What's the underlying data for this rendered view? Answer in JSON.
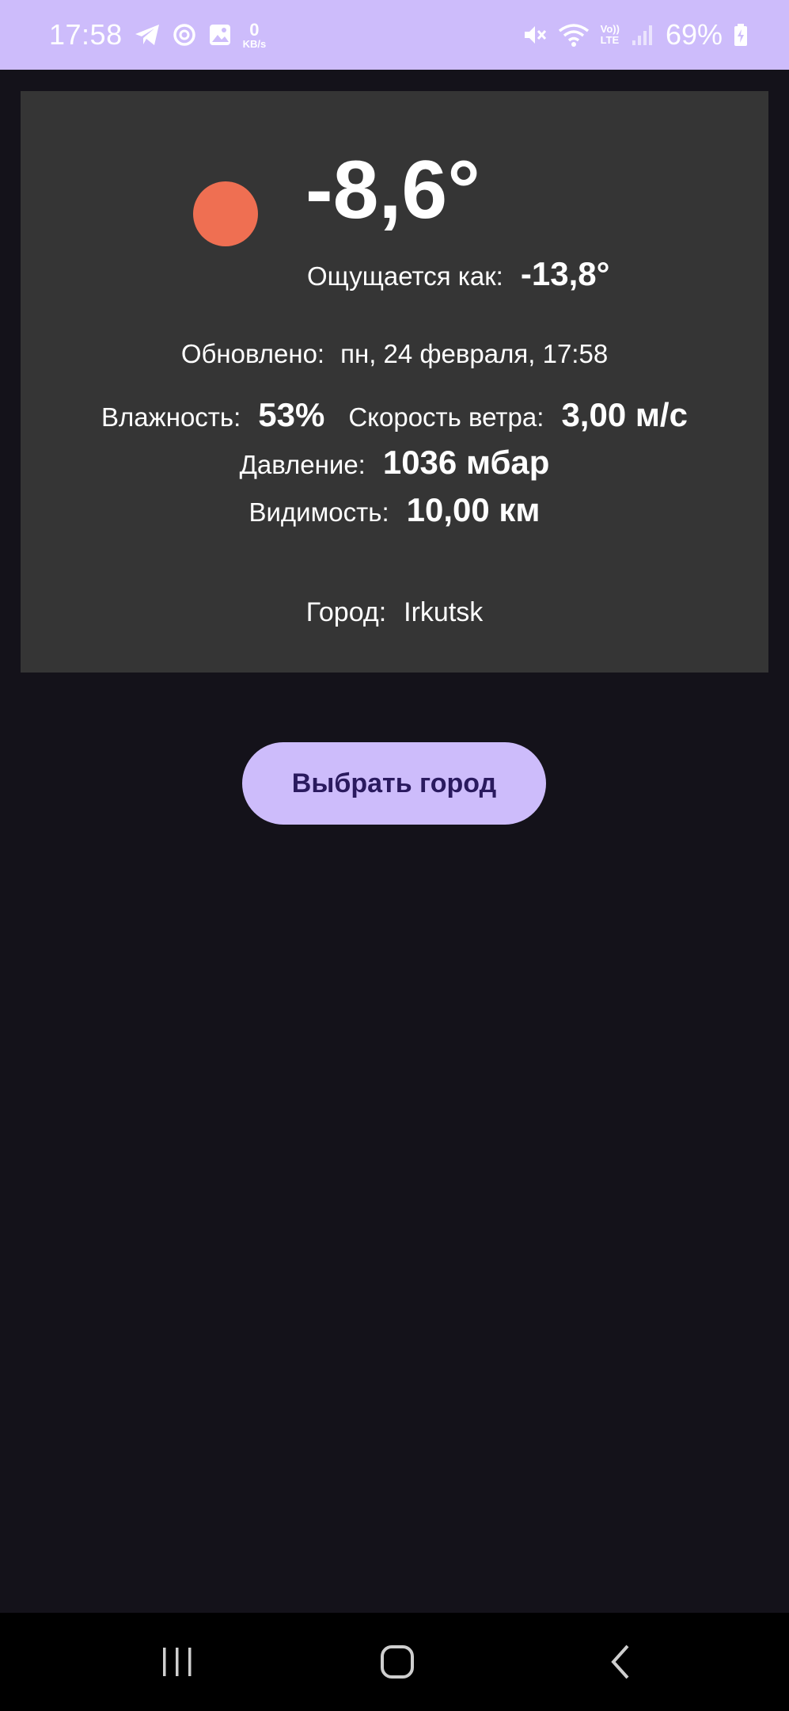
{
  "status_bar": {
    "time": "17:58",
    "data_speed_value": "0",
    "data_speed_unit": "KB/s",
    "lte_top": "Vo))",
    "lte_bottom": "LTE",
    "battery_percent": "69%",
    "icons": [
      "telegram-icon",
      "sync-icon",
      "gallery-icon",
      "mute-icon",
      "wifi-icon",
      "signal-icon",
      "battery-icon"
    ]
  },
  "weather": {
    "temperature": "-8,6°",
    "feels_like_label": "Ощущается как:",
    "feels_like_value": "-13,8°",
    "updated_label": "Обновлено:",
    "updated_value": "пн, 24 февраля, 17:58",
    "humidity_label": "Влажность:",
    "humidity_value": "53%",
    "wind_label": "Скорость ветра:",
    "wind_value": "3,00 м/с",
    "pressure_label": "Давление:",
    "pressure_value": "1036 мбар",
    "visibility_label": "Видимость:",
    "visibility_value": "10,00 км",
    "city_label": "Город:",
    "city_value": "Irkutsk",
    "icon": "sun-icon",
    "icon_color": "#ef6f52"
  },
  "actions": {
    "choose_city_label": "Выбрать город"
  },
  "colors": {
    "accent": "#cdbcfb",
    "background": "#14121a",
    "card": "#353535"
  }
}
